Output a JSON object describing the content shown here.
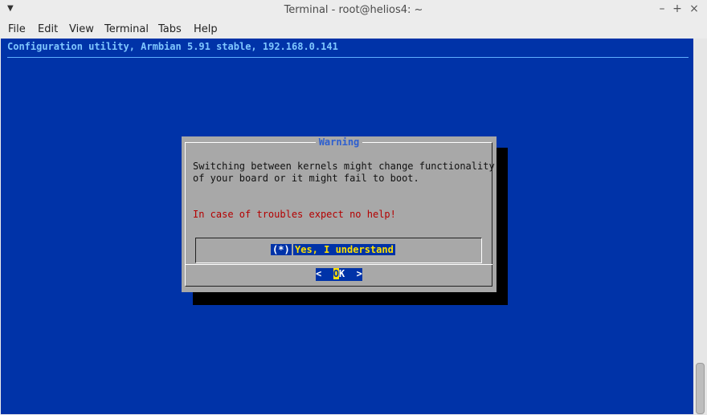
{
  "window": {
    "title": "Terminal - root@helios4: ~",
    "controls": {
      "minimize": "–",
      "maximize": "+",
      "close": "×"
    },
    "menu_icon": "chevron-down-icon"
  },
  "menubar": {
    "items": [
      "File",
      "Edit",
      "View",
      "Terminal",
      "Tabs",
      "Help"
    ]
  },
  "terminal": {
    "header": "Configuration utility, Armbian 5.91 stable, 192.168.0.141",
    "colors": {
      "background": "#0033a8",
      "header": "#7fc7ff"
    }
  },
  "dialog": {
    "title": "Warning",
    "message_line1": "Switching between kernels might change functionality",
    "message_line2": "of your board or it might fail to boot.",
    "warning": "In case of troubles expect no help!",
    "option_marker": "(*)",
    "option_label": "Yes, I understand",
    "ok_left": "<  ",
    "ok_hot": "O",
    "ok_rest": "K",
    "ok_right": "  >"
  }
}
